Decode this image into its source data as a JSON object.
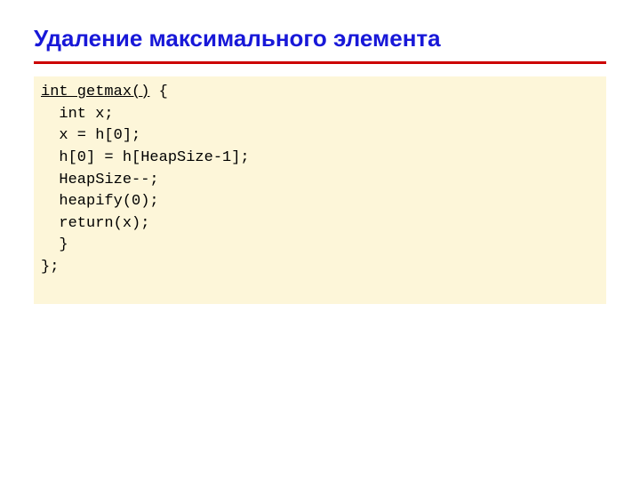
{
  "slide": {
    "title": "Удаление максимального элемента",
    "code": {
      "signature": "int getmax()",
      "open_brace": " {",
      "lines": [
        "  int x;",
        "  x = h[0];",
        "  h[0] = h[HeapSize-1];",
        "  HeapSize--;",
        "  heapify(0);",
        "  return(x);",
        "  }",
        "};"
      ]
    }
  }
}
